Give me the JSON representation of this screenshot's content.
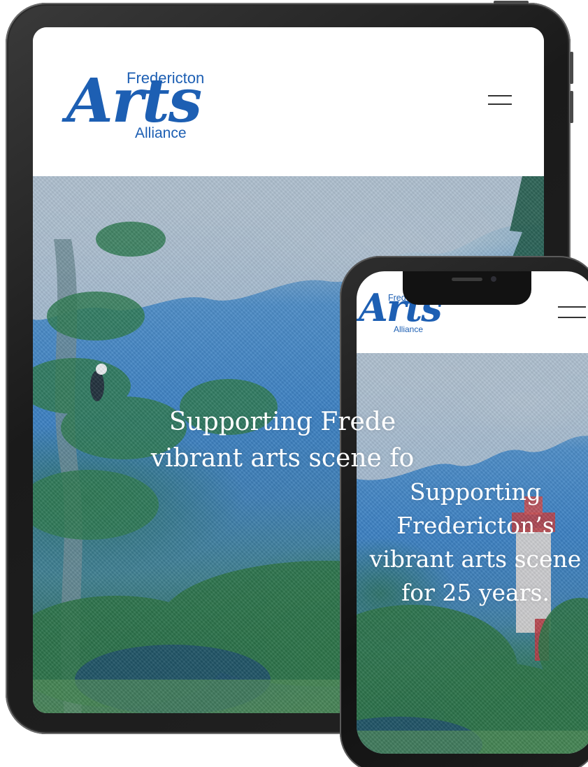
{
  "brand": {
    "top_word": "Fredericton",
    "script_word": "Arts",
    "bottom_word": "Alliance",
    "color": "#1d5fb3"
  },
  "tablet": {
    "hero_lines": [
      "Supporting Frede",
      "vibrant arts scene fo"
    ],
    "menu_icon": "hamburger-menu-icon"
  },
  "phone": {
    "hero_lines": [
      "Supporting",
      "Fredericton’s",
      "vibrant arts scene",
      "for 25 years."
    ],
    "menu_icon": "hamburger-menu-icon"
  },
  "colors": {
    "device_frame": "#1a1a1a",
    "hero_sky": "#3c80c2",
    "hero_text": "#ffffff"
  }
}
